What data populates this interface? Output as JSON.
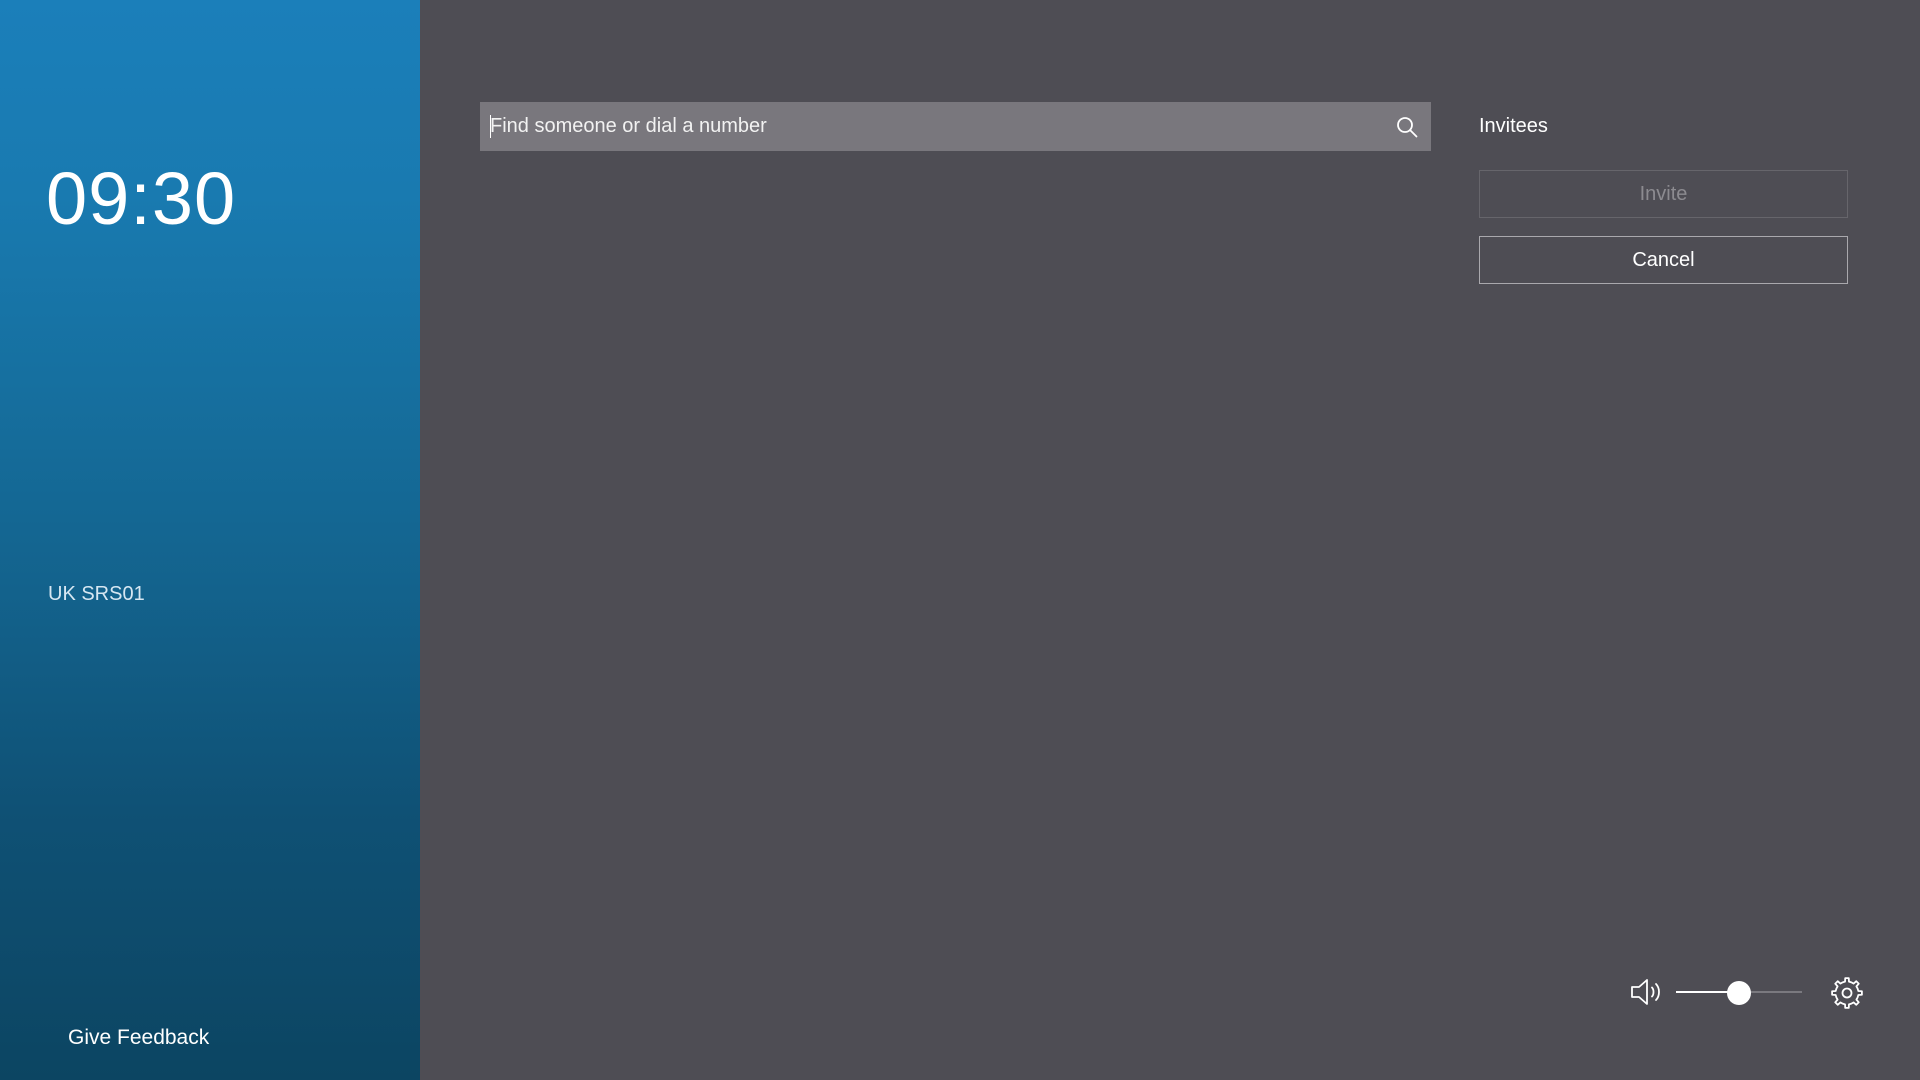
{
  "sidebar": {
    "time": "09:30",
    "room_name": "UK SRS01",
    "feedback_label": "Give Feedback"
  },
  "search": {
    "placeholder": "Find someone or dial a number",
    "value": "",
    "icon": "search-icon"
  },
  "invitees": {
    "title": "Invitees",
    "invite_label": "Invite",
    "invite_enabled": false,
    "cancel_label": "Cancel"
  },
  "controls": {
    "speaker_icon": "speaker-icon",
    "volume_fraction": 0.5,
    "settings_icon": "gear-icon"
  },
  "colors": {
    "sidebar_top": "#1b7fba",
    "sidebar_bottom": "#0c4562",
    "main_background": "#4e4d54",
    "search_background": "#79777d"
  }
}
